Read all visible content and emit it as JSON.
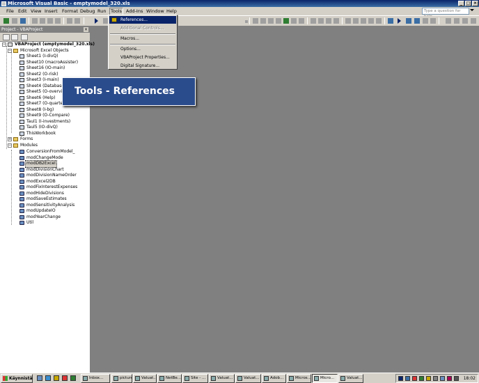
{
  "window": {
    "title": "Microsoft Visual Basic - emptymodel_320.xls"
  },
  "menu": {
    "items": [
      "File",
      "Edit",
      "View",
      "Insert",
      "Format",
      "Debug",
      "Run",
      "Tools",
      "Add-Ins",
      "Window",
      "Help"
    ],
    "active": "Tools",
    "ask_placeholder": "Type a question for help"
  },
  "project": {
    "title": "Project - VBAProject",
    "root": "VBAProject (emptymodel_320.xls)",
    "excel_objects_folder": "Microsoft Excel Objects",
    "excel_objects": [
      "Sheet1 (I-divQ)",
      "Sheet10 (macroAssister)",
      "Sheet16 (IO-main)",
      "Sheet2 (O-risk)",
      "Sheet3 (I-main)",
      "Sheet4 (Database)",
      "Sheet5 (O-overview)",
      "Sheet6 (Help)",
      "Sheet7 (O-quarterly)",
      "Sheet8 (I-bg)",
      "Sheet9 (O-Compare)",
      "Taul1 (I-investments)",
      "Taul5 (IO-divQ)",
      "ThisWorkbook"
    ],
    "forms_folder": "Forms",
    "modules_folder": "Modules",
    "modules": [
      "ConversionFromModel_",
      "modChangeMode",
      "modDB2Excel",
      "modDivisionChart",
      "modDivisionNameOrder",
      "modExcel2DB",
      "modFixInterestExpenses",
      "modHideDivisions",
      "modSaveEstimates",
      "modSensitivityAnalysis",
      "modUpdateIO",
      "modYearChange",
      "Util"
    ],
    "selected_module": "modDB2Excel"
  },
  "tools_menu": {
    "items": [
      {
        "label": "References...",
        "highlighted": true,
        "disabled": false
      },
      {
        "label": "Additional Controls...",
        "highlighted": false,
        "disabled": true
      },
      {
        "label": "Macros...",
        "highlighted": false,
        "disabled": false
      },
      {
        "label": "Options...",
        "highlighted": false,
        "disabled": false
      },
      {
        "label": "VBAProject Properties...",
        "highlighted": false,
        "disabled": false
      },
      {
        "label": "Digital Signature...",
        "highlighted": false,
        "disabled": false
      }
    ]
  },
  "callout": {
    "text": "Tools - References"
  },
  "taskbar": {
    "start_label": "Käynnistä",
    "tasks": [
      "Inbox...",
      "pictures",
      "Valuat...",
      "NetBe...",
      "Site - ...",
      "Valuat...",
      "Valuat...",
      "Adob...",
      "Micros...",
      "Micro...",
      "Valuat..."
    ],
    "active_task": "Micro...",
    "clock": "18:02"
  },
  "colors": {
    "titlebar": "#0a246a",
    "menu_highlight": "#0a246a",
    "callout_bg": "#2b4c8c",
    "workspace": "#808080",
    "chrome": "#d4d0c8"
  }
}
